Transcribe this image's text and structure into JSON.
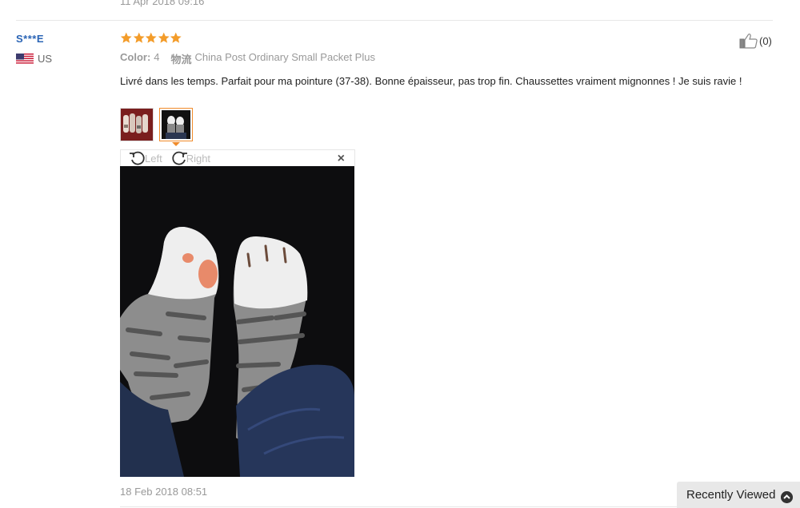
{
  "previous_review": {
    "date": "11 Apr 2018 09:16"
  },
  "review": {
    "user": "S***E",
    "country": "US",
    "stars": 5,
    "color_label": "Color:",
    "color_value": "4",
    "shipping_label": "物流",
    "shipping_value": "China Post Ordinary Small Packet Plus",
    "text": "Livré dans les temps. Parfait pour ma pointure (37-38). Bonne épaisseur, pas trop fin. Chaussettes vraiment mignonnes ! Je suis ravie !",
    "helpful_count": "(0)",
    "date": "18 Feb 2018 08:51",
    "thumbnails": [
      "sock-pack-photo",
      "worn-socks-photo"
    ]
  },
  "viewer": {
    "rotate_left_label": "Left",
    "rotate_right_label": "Right",
    "close_glyph": "×"
  },
  "recently_viewed": {
    "label": "Recently Viewed"
  },
  "colors": {
    "star": "#f39c2a",
    "username": "#2a64b5",
    "active_thumb_border": "#f08b2b"
  }
}
